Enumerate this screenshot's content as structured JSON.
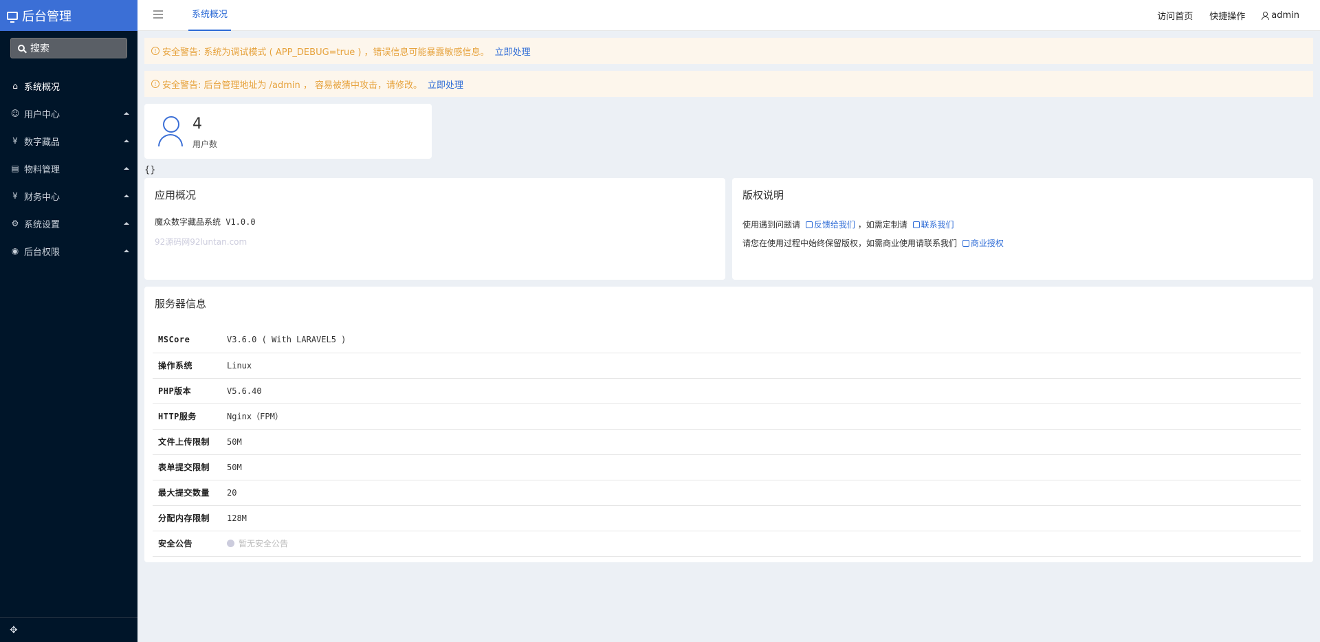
{
  "sidebar": {
    "brand": "后台管理",
    "search": "搜索",
    "items": [
      {
        "label": "系统概况",
        "icon": "home-icon"
      },
      {
        "label": "用户中心",
        "icon": "users-icon"
      },
      {
        "label": "数字藏品",
        "icon": "yen-icon"
      },
      {
        "label": "物料管理",
        "icon": "file-icon"
      },
      {
        "label": "财务中心",
        "icon": "yen-icon"
      },
      {
        "label": "系统设置",
        "icon": "gear-icon"
      },
      {
        "label": "后台权限",
        "icon": "user-circle-icon"
      }
    ]
  },
  "header": {
    "tab": "系统概况",
    "visit": "访问首页",
    "quick": "快捷操作",
    "user": "admin"
  },
  "alerts": [
    {
      "text": "安全警告: 系统为调试模式 ( APP_DEBUG=true ) ，错误信息可能暴露敏感信息。",
      "action": "立即处理"
    },
    {
      "text": "安全警告: 后台管理地址为 /admin ， 容易被猜中攻击，请修改。",
      "action": "立即处理"
    }
  ],
  "stat": {
    "value": "4",
    "label": "用户数"
  },
  "braces": "{}",
  "app": {
    "title": "应用概况",
    "line": "魔众数字藏品系统 V1.0.0",
    "watermark": "92源码网92luntan.com"
  },
  "copyright": {
    "title": "版权说明",
    "line1_pre": "使用遇到问题请",
    "line1_link1": "反馈给我们",
    "line1_mid": "，如需定制请",
    "line1_link2": "联系我们",
    "line2_pre": "请您在使用过程中始终保留版权，如需商业使用请联系我们",
    "line2_link": "商业授权"
  },
  "server": {
    "title": "服务器信息",
    "rows": [
      {
        "key": "MSCore",
        "value": "V3.6.0 ( With LARAVEL5 )"
      },
      {
        "key": "操作系统",
        "value": "Linux"
      },
      {
        "key": "PHP版本",
        "value": "V5.6.40"
      },
      {
        "key": "HTTP服务",
        "value": "Nginx（FPM）"
      },
      {
        "key": "文件上传限制",
        "value": "50M"
      },
      {
        "key": "表单提交限制",
        "value": "50M"
      },
      {
        "key": "最大提交数量",
        "value": "20"
      },
      {
        "key": "分配内存限制",
        "value": "128M"
      },
      {
        "key": "安全公告",
        "value": "暂无安全公告"
      }
    ]
  }
}
